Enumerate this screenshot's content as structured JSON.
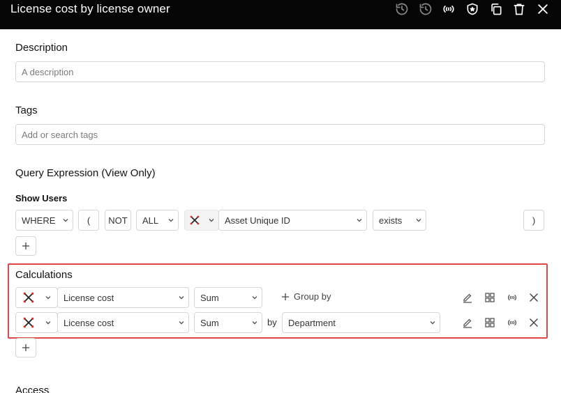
{
  "window": {
    "title": "License cost by license owner"
  },
  "description": {
    "label": "Description",
    "placeholder": "A description"
  },
  "tags": {
    "label": "Tags",
    "placeholder": "Add or search tags"
  },
  "query": {
    "label": "Query Expression (View Only)",
    "entity": "Show Users",
    "row": {
      "where": "WHERE",
      "open_paren": "(",
      "not": "NOT",
      "all": "ALL",
      "field": "Asset Unique ID",
      "operator": "exists",
      "close_paren": ")"
    }
  },
  "calculations": {
    "label": "Calculations",
    "rows": [
      {
        "field": "License cost",
        "aggregation": "Sum",
        "group_by_label": "Group by"
      },
      {
        "field": "License cost",
        "aggregation": "Sum",
        "by_label": "by",
        "group_field": "Department"
      }
    ]
  },
  "access": {
    "label": "Access"
  },
  "colors": {
    "titlebar_bg": "#050505",
    "highlight": "#e04848"
  }
}
